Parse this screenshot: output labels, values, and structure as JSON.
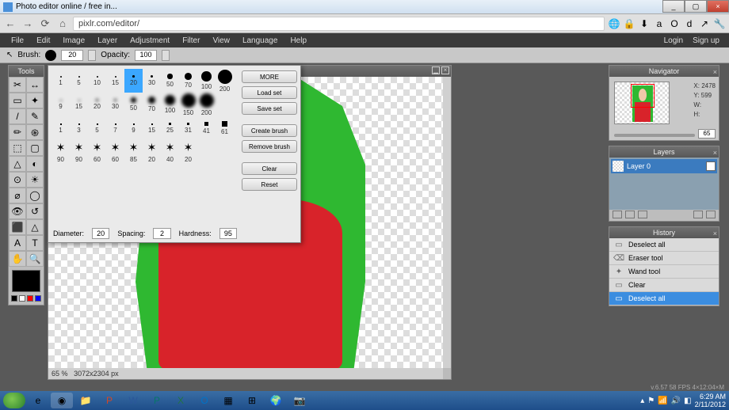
{
  "window": {
    "title": "Photo editor online / free in...",
    "min": "_",
    "max": "▢",
    "close": "×"
  },
  "browser": {
    "url": "pixlr.com/editor/",
    "back": "←",
    "fwd": "→",
    "reload": "⟳",
    "home": "⌂"
  },
  "extensions": [
    "🌐",
    "🔒",
    "⬇",
    "a",
    "O",
    "d",
    "↗",
    "🔧"
  ],
  "menubar": {
    "items": [
      "File",
      "Edit",
      "Image",
      "Layer",
      "Adjustment",
      "Filter",
      "View",
      "Language",
      "Help"
    ],
    "right": [
      "Login",
      "Sign up"
    ]
  },
  "optbar": {
    "brush": "Brush:",
    "brush_size": "20",
    "opacity": "Opacity:",
    "opacity_val": "100"
  },
  "tools_title": "Tools",
  "tools": [
    "✂",
    "↔",
    "▭",
    "✦",
    "/",
    "✎",
    "✏",
    "֍",
    "⬚",
    "▢",
    "△",
    "◐",
    "⊙",
    "☀",
    "⌀",
    "◯",
    "👁",
    "↺",
    "⬛",
    "△",
    "A",
    "T",
    "✋",
    "🔍"
  ],
  "brush_popup": {
    "rows": [
      {
        "sizes": [
          1,
          5,
          10,
          15,
          20,
          30,
          50,
          70,
          100,
          200
        ],
        "soft": false,
        "sel": 4
      },
      {
        "sizes": [
          9,
          15,
          20,
          30,
          50,
          70,
          100,
          150,
          200
        ],
        "soft": true
      },
      {
        "sizes": [
          1,
          3,
          5,
          7,
          9,
          15,
          25,
          31,
          41,
          61
        ],
        "square": true
      },
      {
        "sizes": [
          90,
          90,
          60,
          60,
          85,
          20,
          40,
          20
        ],
        "star": true
      }
    ],
    "btns": [
      "MORE",
      "Load set",
      "Save set",
      "Create brush",
      "Remove brush",
      "Clear",
      "Reset"
    ],
    "diameter_l": "Diameter:",
    "diameter": "20",
    "spacing_l": "Spacing:",
    "spacing": "2",
    "hardness_l": "Hardness:",
    "hardness": "95"
  },
  "canvas": {
    "zoom": "65",
    "pct": "%",
    "dim": "3072x2304 px"
  },
  "navigator": {
    "title": "Navigator",
    "x_l": "X:",
    "x": "2478",
    "y_l": "Y:",
    "y": "599",
    "w_l": "W:",
    "h_l": "H:",
    "zoom": "65"
  },
  "layers": {
    "title": "Layers",
    "layer0": "Layer 0"
  },
  "history": {
    "title": "History",
    "items": [
      {
        "icon": "▭",
        "label": "Deselect all"
      },
      {
        "icon": "⌫",
        "label": "Eraser tool"
      },
      {
        "icon": "✦",
        "label": "Wand tool"
      },
      {
        "icon": "▭",
        "label": "Clear"
      },
      {
        "icon": "▭",
        "label": "Deselect all"
      }
    ],
    "sel": 4
  },
  "app_status": "v.6.57  58 FPS 4×12:04×M",
  "taskbar": {
    "time": "6:29 AM",
    "date": "2/11/2012"
  }
}
